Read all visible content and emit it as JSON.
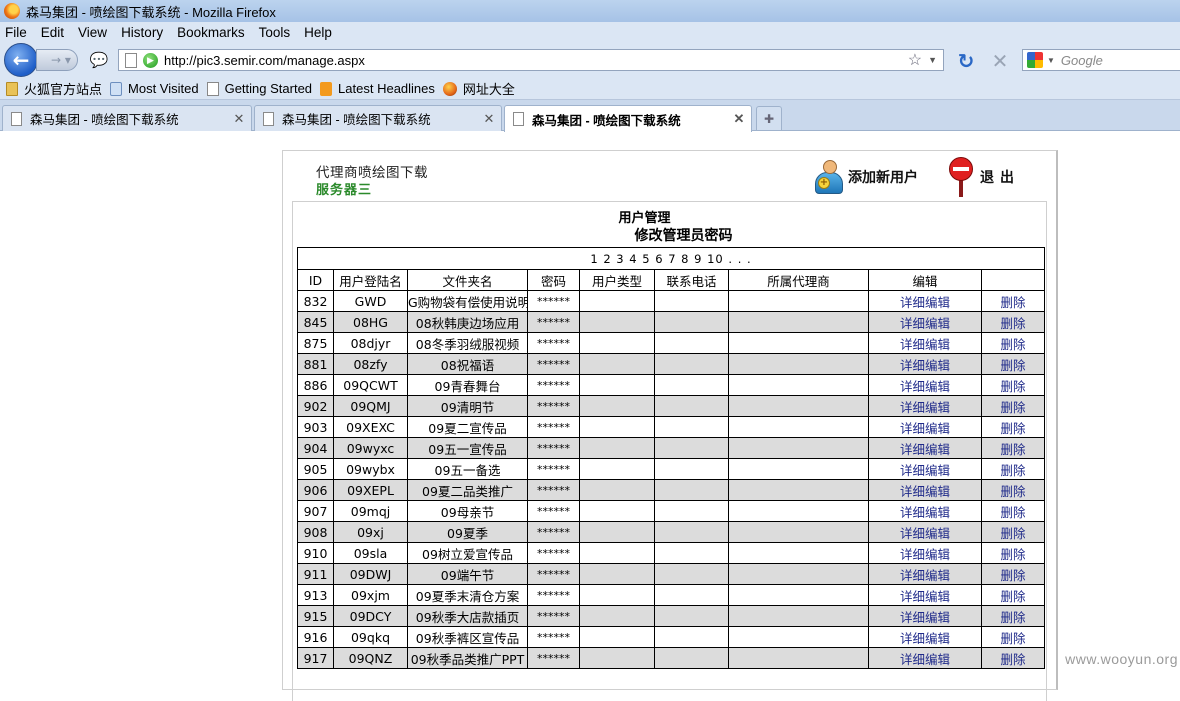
{
  "window": {
    "title": "森马集团 - 喷绘图下载系统 - Mozilla Firefox"
  },
  "menu": [
    "File",
    "Edit",
    "View",
    "History",
    "Bookmarks",
    "Tools",
    "Help"
  ],
  "nav": {
    "url": "http://pic3.semir.com/manage.aspx",
    "search_placeholder": "Google"
  },
  "bookmarks": [
    "火狐官方站点",
    "Most Visited",
    "Getting Started",
    "Latest Headlines",
    "网址大全"
  ],
  "tabs": [
    {
      "label": "森马集团 - 喷绘图下载系统"
    },
    {
      "label": "森马集团 - 喷绘图下载系统"
    },
    {
      "label": "森马集团 - 喷绘图下载系统"
    }
  ],
  "header": {
    "brand_title": "代理商喷绘图下载",
    "brand_sub": "服务器三",
    "add_user": "添加新用户",
    "logout": "退出"
  },
  "page": {
    "title": "用户管理",
    "subtitle": "修改管理员密码",
    "pager": "1 2 3 4 5 6 7 8 9 10 . . ."
  },
  "table": {
    "columns": [
      "ID",
      "用户登陆名",
      "文件夹名",
      "密码",
      "用户类型",
      "联系电话",
      "所属代理商",
      "编辑",
      ""
    ],
    "edit_label": "详细编辑",
    "delete_label": "删除",
    "rows": [
      {
        "id": "832",
        "login": "GWD",
        "folder": "G购物袋有偿使用说明",
        "password": "******"
      },
      {
        "id": "845",
        "login": "08HG",
        "folder": "08秋韩庚边场应用",
        "password": "******"
      },
      {
        "id": "875",
        "login": "08djyr",
        "folder": "08冬季羽绒服视频",
        "password": "******"
      },
      {
        "id": "881",
        "login": "08zfy",
        "folder": "08祝福语",
        "password": "******"
      },
      {
        "id": "886",
        "login": "09QCWT",
        "folder": "09青春舞台",
        "password": "******"
      },
      {
        "id": "902",
        "login": "09QMJ",
        "folder": "09清明节",
        "password": "******"
      },
      {
        "id": "903",
        "login": "09XEXC",
        "folder": "09夏二宣传品",
        "password": "******"
      },
      {
        "id": "904",
        "login": "09wyxc",
        "folder": "09五一宣传品",
        "password": "******"
      },
      {
        "id": "905",
        "login": "09wybx",
        "folder": "09五一备选",
        "password": "******"
      },
      {
        "id": "906",
        "login": "09XEPL",
        "folder": "09夏二品类推广",
        "password": "******"
      },
      {
        "id": "907",
        "login": "09mqj",
        "folder": "09母亲节",
        "password": "******"
      },
      {
        "id": "908",
        "login": "09xj",
        "folder": "09夏季",
        "password": "******"
      },
      {
        "id": "910",
        "login": "09sla",
        "folder": "09树立爱宣传品",
        "password": "******"
      },
      {
        "id": "911",
        "login": "09DWJ",
        "folder": "09端午节",
        "password": "******"
      },
      {
        "id": "913",
        "login": "09xjm",
        "folder": "09夏季末清仓方案",
        "password": "******"
      },
      {
        "id": "915",
        "login": "09DCY",
        "folder": "09秋季大店款插页",
        "password": "******"
      },
      {
        "id": "916",
        "login": "09qkq",
        "folder": "09秋季裤区宣传品",
        "password": "******"
      },
      {
        "id": "917",
        "login": "09QNZ",
        "folder": "09秋季品类推广PPT",
        "password": "******"
      }
    ]
  },
  "watermark": "www.wooyun.org"
}
